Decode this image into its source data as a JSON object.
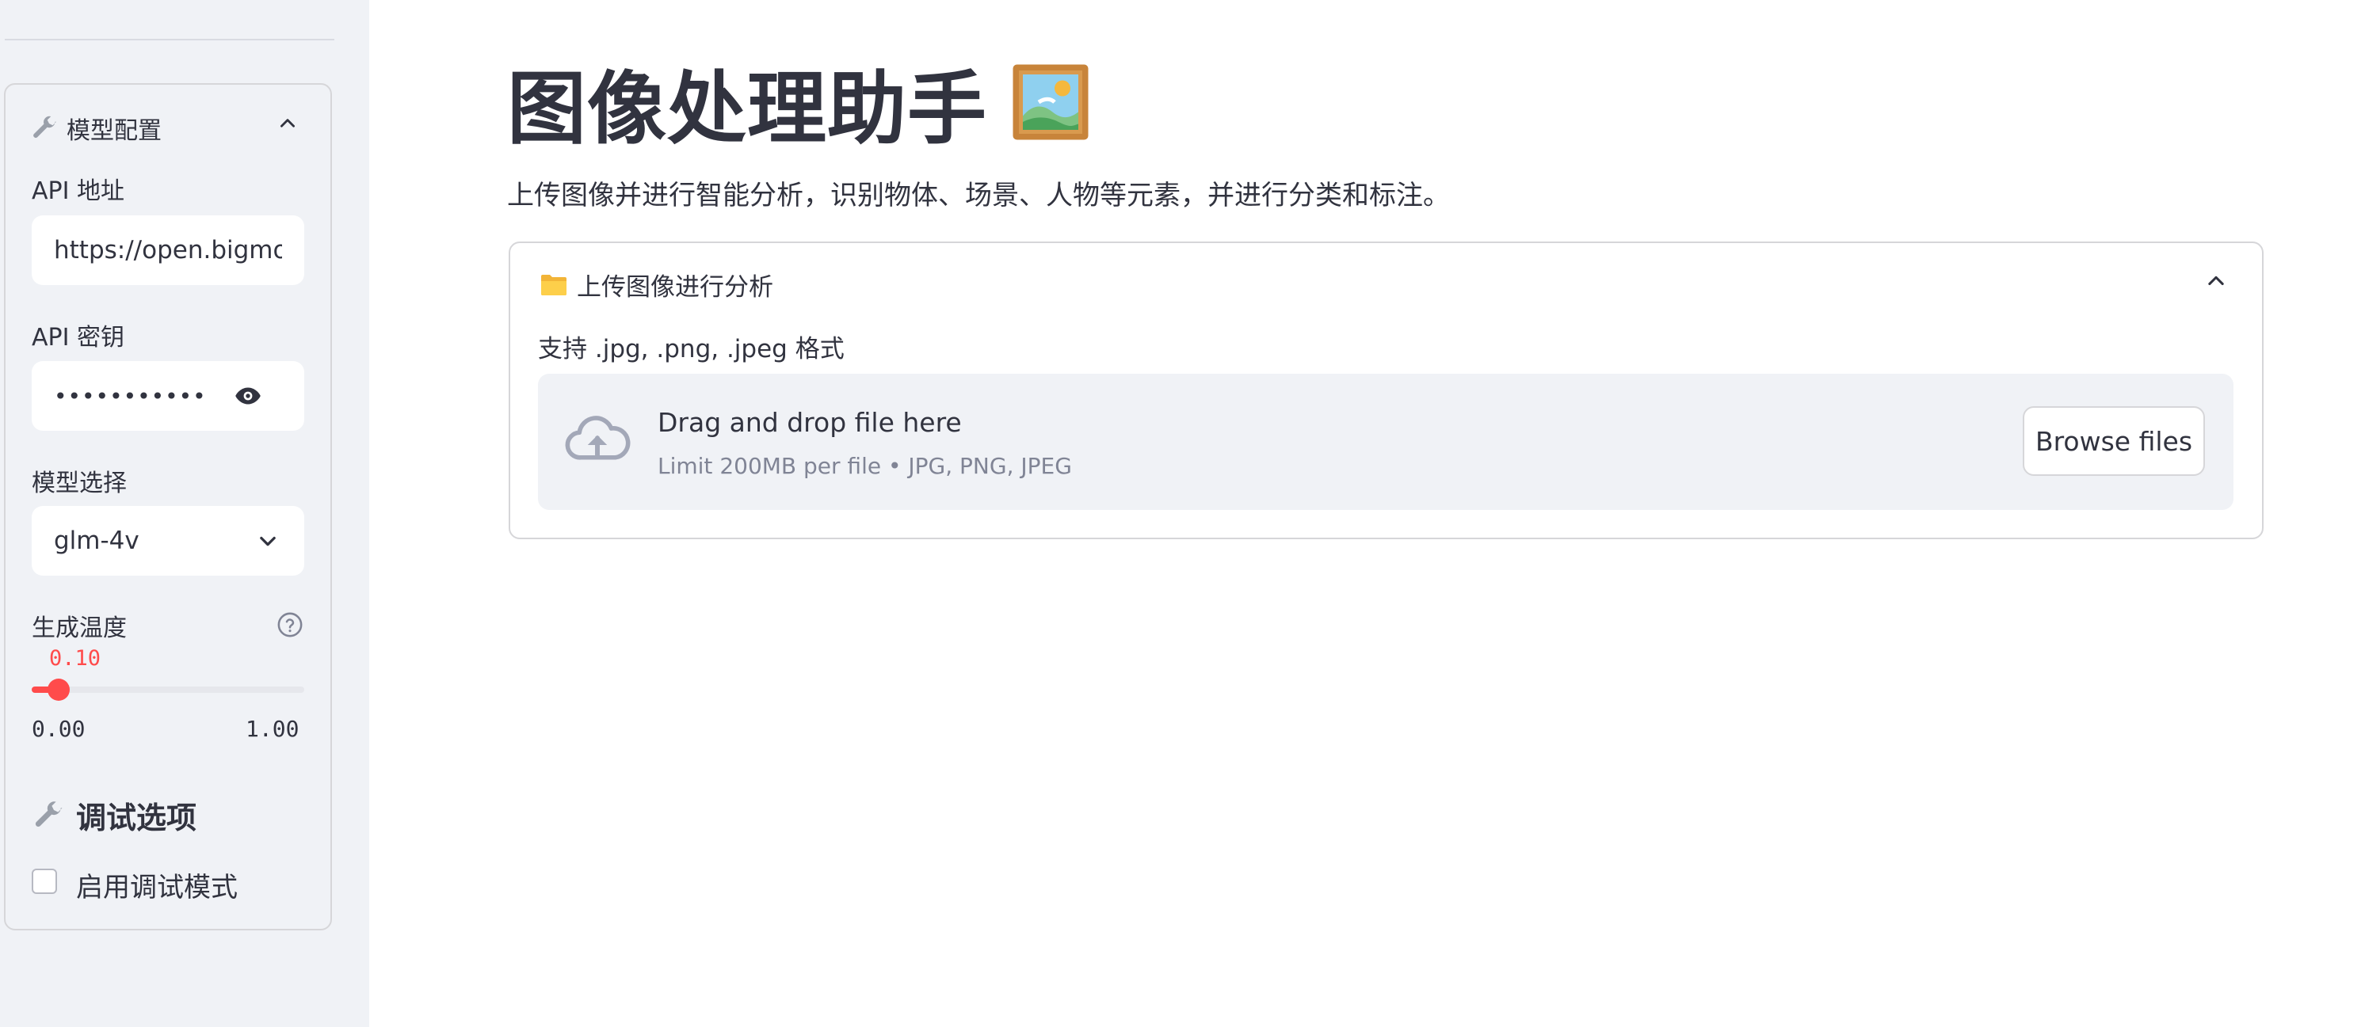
{
  "sidebar": {
    "expander_title": "模型配置",
    "api_url": {
      "label": "API 地址",
      "value": "https://open.bigmodel.cn"
    },
    "api_key": {
      "label": "API 密钥",
      "value": "•••••••••••••••••"
    },
    "model": {
      "label": "模型选择",
      "selected": "glm-4v"
    },
    "temperature": {
      "label": "生成温度",
      "value": 0.1,
      "value_text": "0.10",
      "min_text": "0.00",
      "max_text": "1.00",
      "min": 0,
      "max": 1
    },
    "debug_title": "调试选项",
    "debug_checkbox_label": "启用调试模式"
  },
  "main": {
    "title": "图像处理助手",
    "subtitle": "上传图像并进行智能分析，识别物体、场景、人物等元素，并进行分类和标注。",
    "upload": {
      "expander_title": "上传图像进行分析",
      "hint": "支持 .jpg, .png, .jpeg 格式",
      "drop_title": "Drag and drop file here",
      "drop_subtitle": "Limit 200MB per file • JPG, PNG, JPEG",
      "browse_label": "Browse files"
    }
  },
  "colors": {
    "accent": "#ff4b4b",
    "text": "#31333f",
    "sidebar_bg": "#f0f2f6"
  },
  "icons": [
    "wrench-icon",
    "chevron-up-icon",
    "eye-icon",
    "chevron-down-icon",
    "help-icon",
    "framed-picture-icon",
    "folder-icon",
    "cloud-upload-icon"
  ]
}
